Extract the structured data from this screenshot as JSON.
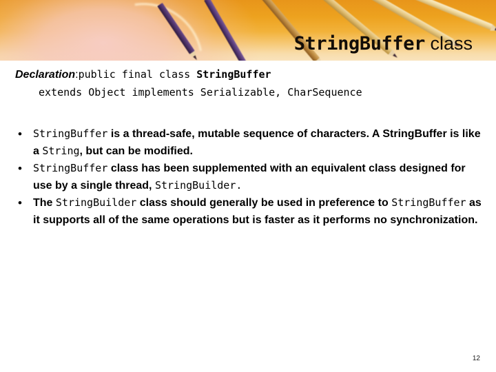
{
  "slide": {
    "title_mono": "StringBuffer",
    "title_sans": " class",
    "page_number": "12"
  },
  "banner": {
    "image_alt": "colored-pencils-photo",
    "colors": {
      "amber": "#eda21f",
      "cream": "#f9e3bd",
      "pink_blur": "#f7cdc4",
      "pencil_lead": "#3a2230"
    }
  },
  "declaration": {
    "label": "Declaration",
    "colon": ":",
    "line1_code": "public final class ",
    "line1_class": "StringBuffer",
    "line2_code": "extends Object implements Serializable, CharSequence"
  },
  "bullets": [
    {
      "marker": "•",
      "parts": [
        {
          "style": "code",
          "text": "StringBuffer"
        },
        {
          "style": "sans",
          "text": " is a thread-safe, mutable sequence of characters. A StringBuffer is like a "
        },
        {
          "style": "code",
          "text": "String"
        },
        {
          "style": "sans",
          "text": ", but can be modified."
        }
      ]
    },
    {
      "marker": "•",
      "parts": [
        {
          "style": "code",
          "text": "StringBuffer"
        },
        {
          "style": "sans",
          "text": " class has been supplemented with an equivalent class designed for use by a single thread, "
        },
        {
          "style": "code",
          "text": "StringBuilder."
        }
      ]
    },
    {
      "marker": "•",
      "parts": [
        {
          "style": "sans",
          "text": "The "
        },
        {
          "style": "code",
          "text": "StringBuilder"
        },
        {
          "style": "sans",
          "text": " class should generally be used in preference to "
        },
        {
          "style": "code",
          "text": "StringBuffer"
        },
        {
          "style": "sans",
          "text": " as it supports all of the same operations but is faster as it performs no synchronization."
        }
      ]
    }
  ]
}
